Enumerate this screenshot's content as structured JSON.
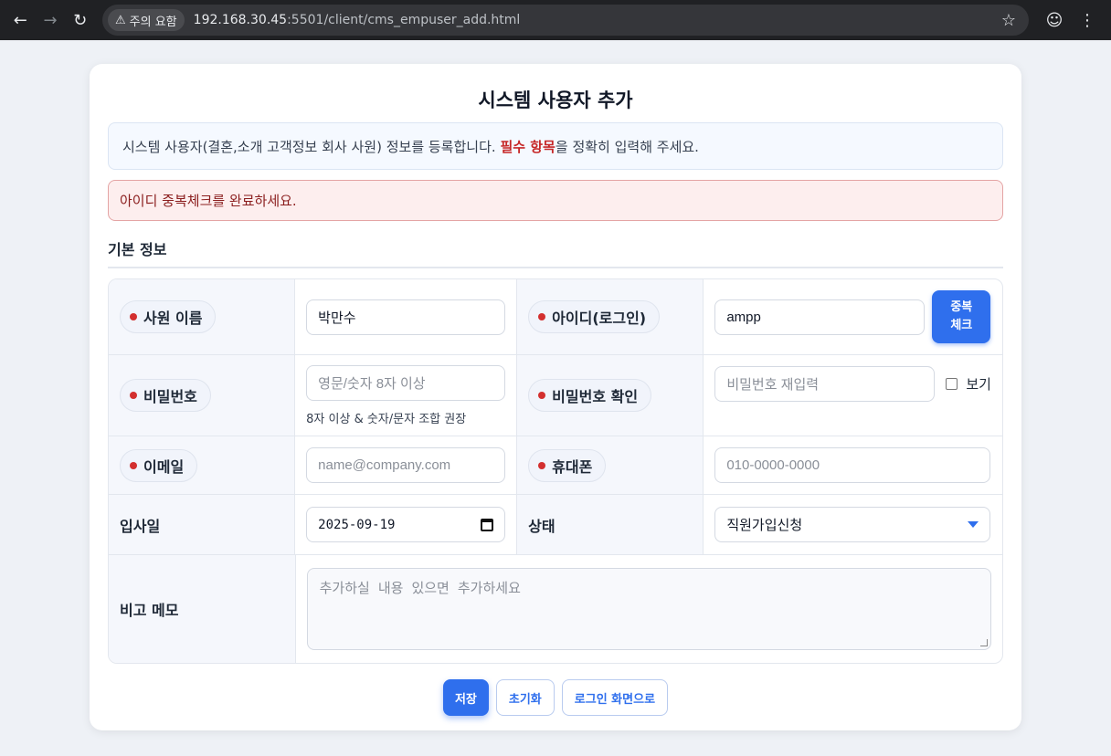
{
  "browser": {
    "security_label": "주의 요함",
    "url_host": "192.168.30.45",
    "url_path": ":5501/client/cms_empuser_add.html"
  },
  "page": {
    "title": "시스템 사용자 추가",
    "info_prefix": "시스템 사용자(결혼,소개 고객정보 회사 사원) 정보를 등록합니다. ",
    "info_required": "필수 항목",
    "info_suffix": "을 정확히 입력해 주세요.",
    "alert": "아이디 중복체크를 완료하세요.",
    "section_title": "기본 정보"
  },
  "form": {
    "name_label": "사원 이름",
    "name_value": "박만수",
    "id_label": "아이디(로그인)",
    "id_value": "ampp",
    "dup_check_line1": "중복",
    "dup_check_line2": "체크",
    "password_label": "비밀번호",
    "password_placeholder": "영문/숫자 8자 이상",
    "password_hint": "8자 이상 & 숫자/문자 조합 권장",
    "password_confirm_label": "비밀번호 확인",
    "password_confirm_placeholder": "비밀번호 재입력",
    "show_label": "보기",
    "email_label": "이메일",
    "email_placeholder": "name@company.com",
    "phone_label": "휴대폰",
    "phone_placeholder": "010-0000-0000",
    "join_date_label": "입사일",
    "join_date_value": "2025-09-19",
    "status_label": "상태",
    "status_value": "직원가입신청",
    "memo_label": "비고 메모",
    "memo_placeholder": "추가하실 내용 있으면 추가하세요"
  },
  "actions": {
    "save": "저장",
    "reset": "초기화",
    "to_login": "로그인 화면으로"
  },
  "colors": {
    "accent": "#2f6fed",
    "required": "#d32f2f",
    "alert_bg": "#fdeeee"
  }
}
